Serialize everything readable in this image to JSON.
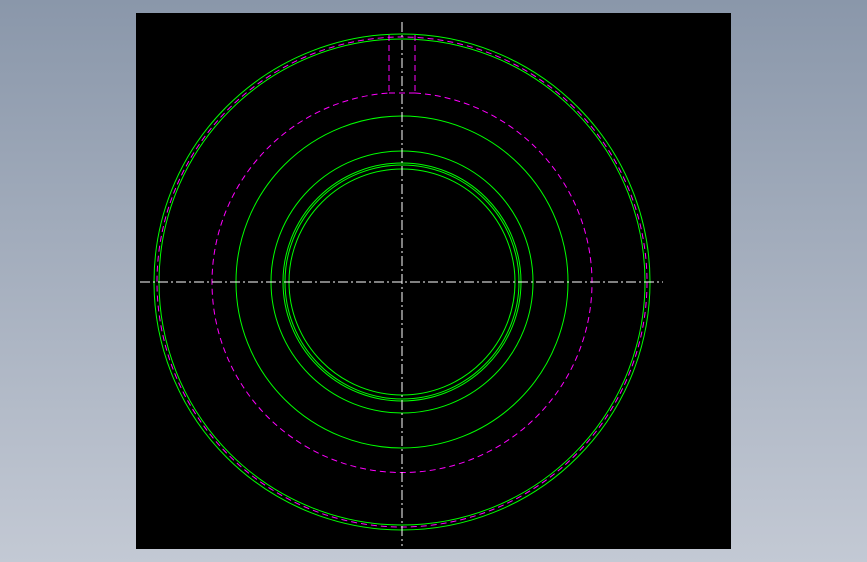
{
  "colors": {
    "background_gradient_top": "#8a97aa",
    "background_gradient_bottom": "#c3c9d4",
    "viewport": "#000000",
    "solid_geometry": "#00ff00",
    "hidden_geometry": "#ff00ff",
    "centerline": "#ffffff"
  },
  "drawing": {
    "view": "front",
    "solid_circle_count": 8,
    "hidden_circle_count": 2,
    "has_keyway_slot": true,
    "centerlines": [
      "horizontal",
      "vertical"
    ]
  }
}
